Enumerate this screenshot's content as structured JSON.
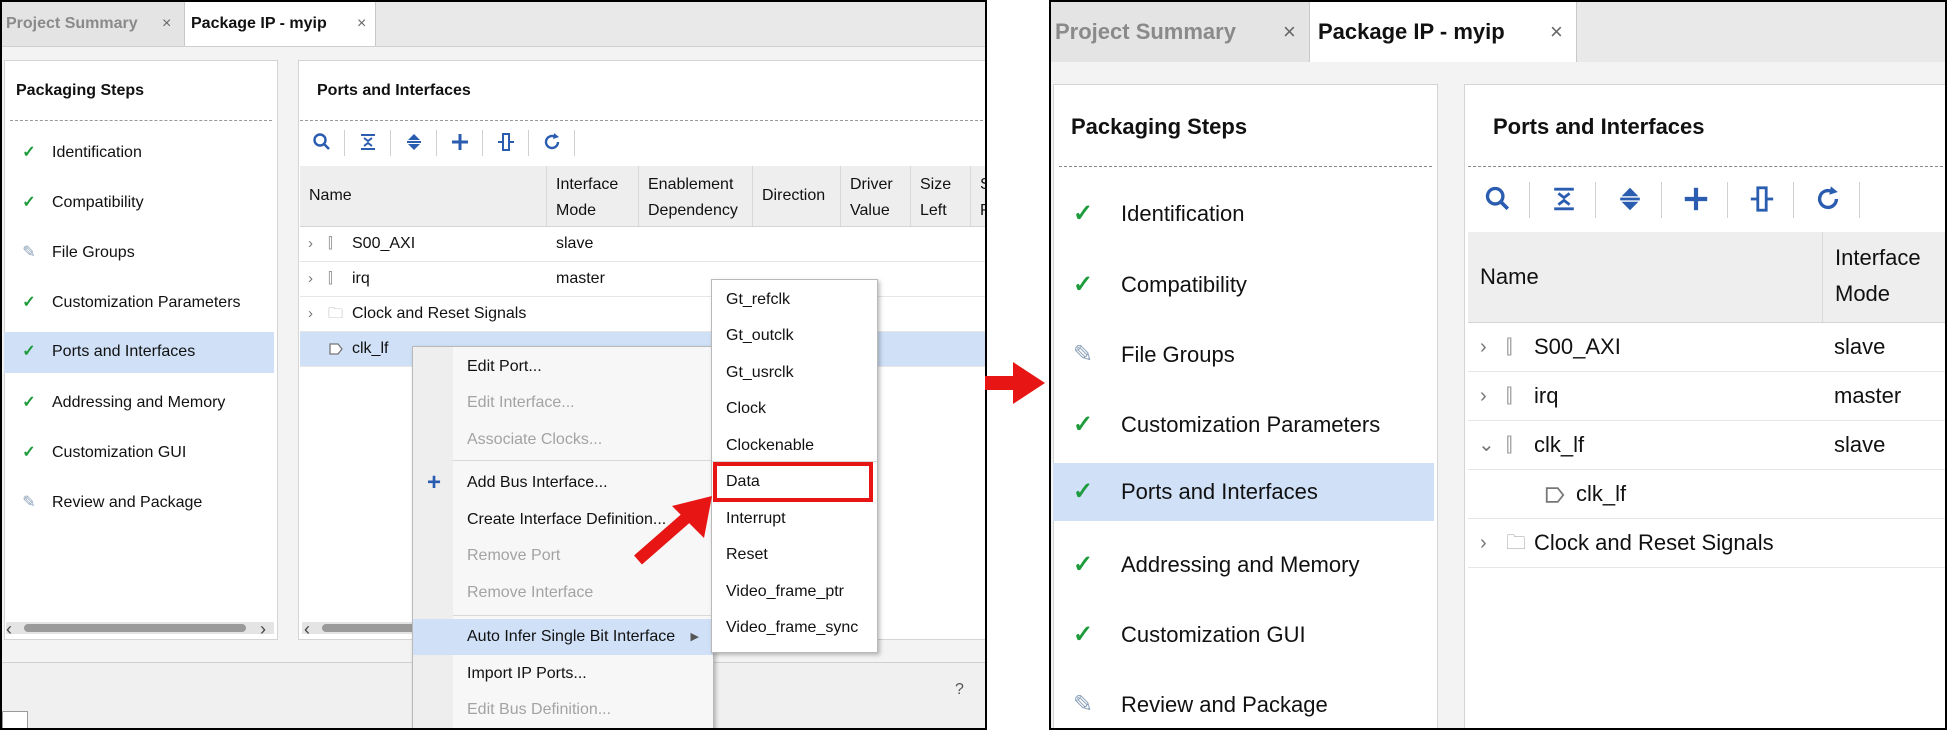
{
  "left": {
    "tabs": [
      {
        "label": "Project Summary",
        "active": false
      },
      {
        "label": "Package IP - myip",
        "active": true
      }
    ],
    "close_glyph": "×",
    "packaging_title": "Packaging Steps",
    "steps": [
      {
        "label": "Identification",
        "icon": "check-icon",
        "selected": false
      },
      {
        "label": "Compatibility",
        "icon": "check-icon",
        "selected": false
      },
      {
        "label": "File Groups",
        "icon": "edit-icon",
        "selected": false
      },
      {
        "label": "Customization Parameters",
        "icon": "check-icon",
        "selected": false
      },
      {
        "label": "Ports and Interfaces",
        "icon": "check-icon",
        "selected": true
      },
      {
        "label": "Addressing and Memory",
        "icon": "check-icon",
        "selected": false
      },
      {
        "label": "Customization GUI",
        "icon": "check-icon",
        "selected": false
      },
      {
        "label": "Review and Package",
        "icon": "edit-icon",
        "selected": false
      }
    ],
    "ports_title": "Ports and Interfaces",
    "toolbar_icons": [
      "search-icon",
      "collapse-all-icon",
      "expand-all-icon",
      "add-icon",
      "bus-interface-icon",
      "refresh-icon"
    ],
    "columns": {
      "name": "Name",
      "mode": [
        "Interface",
        "Mode"
      ],
      "dependency": [
        "Enablement",
        "Dependency"
      ],
      "direction": "Direction",
      "driver": [
        "Driver",
        "Value"
      ],
      "size_left": [
        "Size",
        "Left"
      ],
      "partial": [
        "S",
        "R"
      ]
    },
    "rows": [
      {
        "name": "S00_AXI",
        "mode": "slave"
      },
      {
        "name": "irq",
        "mode": "master"
      },
      {
        "name": "Clock and Reset Signals",
        "mode": ""
      },
      {
        "name": "clk_lf",
        "mode": ""
      }
    ],
    "context_menu": [
      {
        "label": "Edit Port...",
        "enabled": true
      },
      {
        "label": "Edit Interface...",
        "enabled": false
      },
      {
        "label": "Associate Clocks...",
        "enabled": false
      },
      {
        "label": "Add Bus Interface...",
        "enabled": true
      },
      {
        "label": "Create Interface Definition...",
        "enabled": true
      },
      {
        "label": "Remove Port",
        "enabled": false
      },
      {
        "label": "Remove Interface",
        "enabled": false
      },
      {
        "label": "Auto Infer Single Bit Interface",
        "enabled": true
      },
      {
        "label": "Import IP Ports...",
        "enabled": true
      },
      {
        "label": "Edit Bus Definition...",
        "enabled": false
      }
    ],
    "submenu": [
      "Gt_refclk",
      "Gt_outclk",
      "Gt_usrclk",
      "Clock",
      "Clockenable",
      "Data",
      "Interrupt",
      "Reset",
      "Video_frame_ptr",
      "Video_frame_sync"
    ],
    "submenu_highlighted": "Data",
    "help_glyph": "?"
  },
  "right": {
    "tabs": [
      {
        "label": "Project Summary",
        "active": false
      },
      {
        "label": "Package IP - myip",
        "active": true
      }
    ],
    "close_glyph": "×",
    "packaging_title": "Packaging Steps",
    "steps": [
      {
        "label": "Identification",
        "icon": "check-icon",
        "selected": false
      },
      {
        "label": "Compatibility",
        "icon": "check-icon",
        "selected": false
      },
      {
        "label": "File Groups",
        "icon": "edit-icon",
        "selected": false
      },
      {
        "label": "Customization Parameters",
        "icon": "check-icon",
        "selected": false
      },
      {
        "label": "Ports and Interfaces",
        "icon": "check-icon",
        "selected": true
      },
      {
        "label": "Addressing and Memory",
        "icon": "check-icon",
        "selected": false
      },
      {
        "label": "Customization GUI",
        "icon": "check-icon",
        "selected": false
      },
      {
        "label": "Review and Package",
        "icon": "edit-icon",
        "selected": false
      }
    ],
    "ports_title": "Ports and Interfaces",
    "columns": {
      "name": "Name",
      "mode": [
        "Interface",
        "Mode"
      ]
    },
    "rows": [
      {
        "name": "S00_AXI",
        "mode": "slave",
        "expanded": false
      },
      {
        "name": "irq",
        "mode": "master",
        "expanded": false
      },
      {
        "name": "clk_lf",
        "mode": "slave",
        "expanded": true
      },
      {
        "name": "clk_lf",
        "mode": "",
        "child": true
      },
      {
        "name": "Clock and Reset Signals",
        "mode": "",
        "expanded": false
      }
    ]
  },
  "colors": {
    "check": "#1e9b3c",
    "selection": "#cfe0f7",
    "accent_blue": "#2a5db0",
    "highlight_red": "#e81515",
    "arrow_red": "#e81515"
  }
}
